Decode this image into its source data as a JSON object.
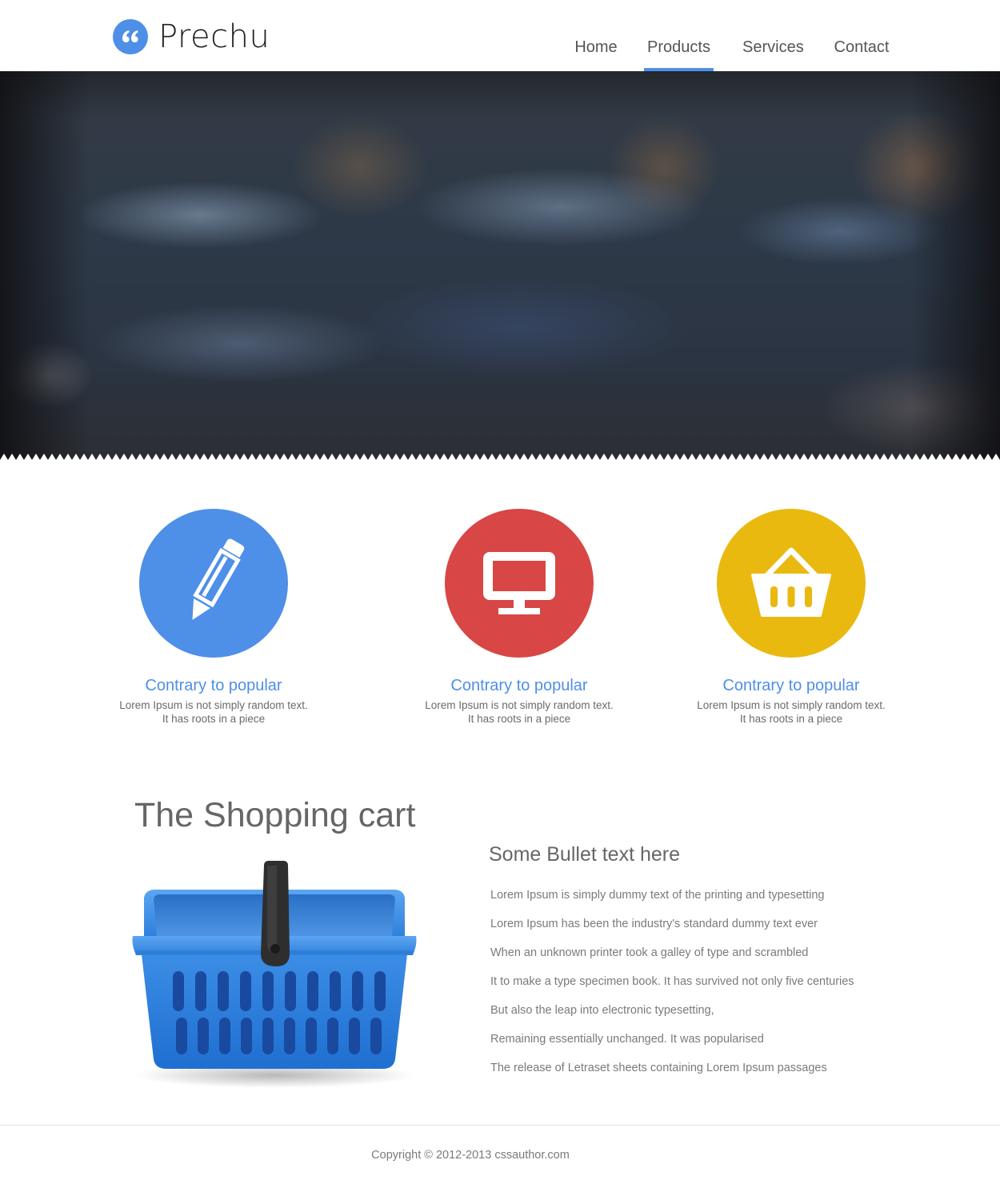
{
  "brand": {
    "name": "Prechu",
    "logo_icon": "quote-icon",
    "accent_color": "#4e8fe8"
  },
  "nav": {
    "items": [
      {
        "label": "Home",
        "active": false
      },
      {
        "label": "Products",
        "active": true
      },
      {
        "label": "Services",
        "active": false
      },
      {
        "label": "Contact",
        "active": false
      }
    ]
  },
  "hero": {
    "image": "blurred-photo",
    "bottom_edge": "zigzag"
  },
  "features": [
    {
      "icon": "pencil-icon",
      "color": "#4e8fe8",
      "title": "Contrary to popular",
      "text_line1": "Lorem Ipsum is not simply random text.",
      "text_line2": "It has roots in a piece"
    },
    {
      "icon": "monitor-icon",
      "color": "#d84646",
      "title": "Contrary to popular",
      "text_line1": "Lorem Ipsum is not simply random text.",
      "text_line2": "It has roots in a piece"
    },
    {
      "icon": "basket-icon",
      "color": "#e9b910",
      "title": "Contrary to popular",
      "text_line1": "Lorem Ipsum is not simply random text.",
      "text_line2": "It has roots in a piece"
    }
  ],
  "cart_section": {
    "heading": "The Shopping cart",
    "illustration": "shopping-basket-illustration",
    "bullets_heading": "Some Bullet text here",
    "bullets": [
      "Lorem Ipsum is simply dummy text of the printing and typesetting",
      "Lorem Ipsum has been the industry's standard dummy text ever",
      "When an unknown printer took a galley of type and scrambled",
      "It to make a type specimen book. It has survived not only five centuries",
      "But also the leap into electronic typesetting,",
      "Remaining essentially unchanged. It was popularised",
      "The release of Letraset sheets containing Lorem Ipsum passages"
    ]
  },
  "footer": {
    "copyright": "Copyright © 2012-2013 cssauthor.com"
  }
}
